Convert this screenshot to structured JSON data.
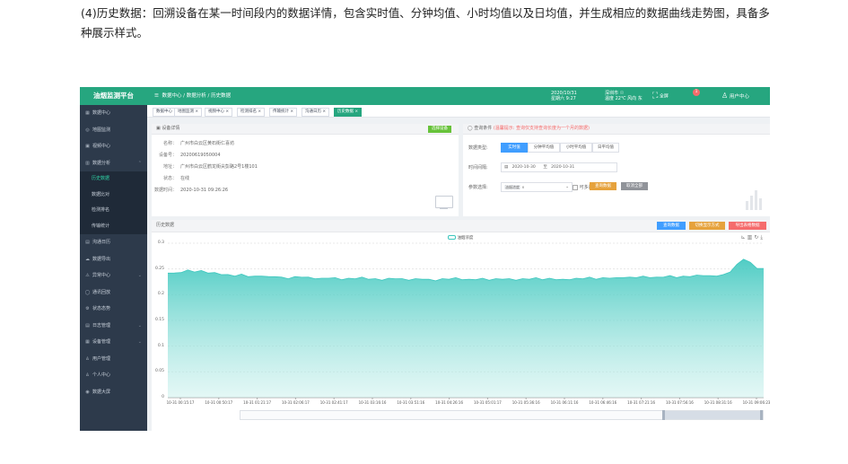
{
  "intro_text": "(4)历史数据：回溯设备在某一时间段内的数据详情，包含实时值、分钟均值、小时均值以及日均值，并生成相应的数据曲线走势图，具备多种展示样式。",
  "app": {
    "logo": "油烟监测平台",
    "breadcrumb": "数据中心 / 数据分析 / 历史数据",
    "datetime_line1": "2020/10/31",
    "datetime_line2": "星期六 9:27",
    "weather_line1": "深圳市 ☉",
    "weather_line2": "温度 22℃ 风向 东",
    "fullscreen_label": "全屏",
    "badge_count": "1",
    "user_label": "用户中心"
  },
  "sidebar": {
    "items_top": [
      {
        "icon": "▦",
        "label": "数据中心"
      },
      {
        "icon": "◎",
        "label": "地图监测"
      },
      {
        "icon": "▣",
        "label": "视频中心"
      },
      {
        "icon": "▥",
        "label": "数据分析",
        "arrow": "⌃"
      }
    ],
    "sub_items": [
      {
        "label": "历史数据",
        "active": true
      },
      {
        "label": "数据比对"
      },
      {
        "label": "检测排名"
      },
      {
        "label": "传输统计"
      }
    ],
    "items_bottom": [
      {
        "icon": "▤",
        "label": "沟通日历"
      },
      {
        "icon": "☁",
        "label": "数据导出"
      },
      {
        "icon": "⚠",
        "label": "异常中心",
        "arrow": "⌄"
      },
      {
        "icon": "◯",
        "label": "通讯回放"
      },
      {
        "icon": "⚙",
        "label": "状态态势"
      },
      {
        "icon": "▤",
        "label": "日志管理",
        "arrow": "⌄"
      },
      {
        "icon": "▦",
        "label": "设备管理",
        "arrow": "⌄"
      },
      {
        "icon": "♙",
        "label": "用户管理"
      },
      {
        "icon": "♙",
        "label": "个人中心"
      },
      {
        "icon": "◉",
        "label": "数据大屏"
      }
    ]
  },
  "tabs": [
    "数据中心",
    "地图监测 ×",
    "视频中心 ×",
    "检测排名 ×",
    "传输统计 ×",
    "沟通日历 ×",
    "历史数据 ×"
  ],
  "device_panel": {
    "title": "设备详情",
    "select_button": "选择设备",
    "rows": [
      {
        "label": "名称：",
        "value": "广州市白云区黄石街仁喜坊"
      },
      {
        "label": "设备号：",
        "value": "20200619050004"
      },
      {
        "label": "地址：",
        "value": "广州市白云区鹤龙街尖彭路2号1楼101"
      },
      {
        "label": "状态：",
        "value": "在线"
      },
      {
        "label": "数据时间：",
        "value": "2020-10-31 09:26:26"
      }
    ]
  },
  "query_panel": {
    "title": "查询条件",
    "warning": "(温馨提示: 查询仅支持查询长度为一个月的数据)",
    "type_label": "数据类型:",
    "types": [
      "实时值",
      "分钟平均值",
      "小时平均值",
      "日平均值"
    ],
    "time_label": "时间间隔:",
    "date_start": "2020-10-30",
    "date_sep": "至",
    "date_end": "2020-10-31",
    "param_label": "参数选择:",
    "param_value": "油烟浓度",
    "multi_label": "可多选",
    "query_button": "查询数据",
    "reset_button": "取消全部"
  },
  "history_panel": {
    "title": "历史数据",
    "btn_query": "查询数据",
    "btn_switch": "切换显示方式",
    "btn_export": "导出表格数据"
  },
  "chart_data": {
    "type": "area",
    "legend": [
      "油烟浓度"
    ],
    "ylim": [
      0,
      0.3
    ],
    "yticks": [
      "0.3",
      "0.25",
      "0.2",
      "0.15",
      "0.1",
      "0.05",
      "0"
    ],
    "x_tick_labels": [
      "10-31 00:15:17",
      "10-31 00:50:17",
      "10-31 01:21:17",
      "10-31 02:06:17",
      "10-31 02:41:17",
      "10-31 03:16:16",
      "10-31 03:51:16",
      "10-31 04:26:16",
      "10-31 05:01:17",
      "10-31 05:36:16",
      "10-31 06:11:16",
      "10-31 06:46:16",
      "10-31 07:21:16",
      "10-31 07:56:16",
      "10-31 08:31:16",
      "10-31 09:06:23"
    ],
    "series": [
      {
        "name": "油烟浓度",
        "color": "#3dc7be",
        "values": [
          0.243,
          0.241,
          0.244,
          0.247,
          0.245,
          0.246,
          0.243,
          0.242,
          0.24,
          0.238,
          0.237,
          0.239,
          0.236,
          0.235,
          0.237,
          0.234,
          0.236,
          0.233,
          0.232,
          0.234,
          0.235,
          0.233,
          0.232,
          0.231,
          0.233,
          0.232,
          0.23,
          0.231,
          0.232,
          0.233,
          0.231,
          0.23,
          0.229,
          0.231,
          0.232,
          0.23,
          0.229,
          0.23,
          0.231,
          0.229,
          0.228,
          0.23,
          0.231,
          0.232,
          0.23,
          0.229,
          0.23,
          0.231,
          0.229,
          0.23,
          0.231,
          0.23,
          0.229,
          0.23,
          0.231,
          0.232,
          0.23,
          0.231,
          0.23,
          0.229,
          0.23,
          0.231,
          0.232,
          0.233,
          0.231,
          0.232,
          0.233,
          0.232,
          0.234,
          0.233,
          0.234,
          0.235,
          0.234,
          0.233,
          0.235,
          0.236,
          0.234,
          0.235,
          0.236,
          0.237,
          0.238,
          0.236,
          0.237,
          0.238,
          0.245,
          0.258,
          0.27,
          0.262,
          0.252,
          0.25
        ]
      }
    ]
  },
  "colors": {
    "brand": "#26a67f",
    "sidebar": "#2d3a4b",
    "blue": "#409eff",
    "orange": "#e6a23c",
    "red": "#f56c6c",
    "green": "#67c23a",
    "grey": "#909399"
  }
}
